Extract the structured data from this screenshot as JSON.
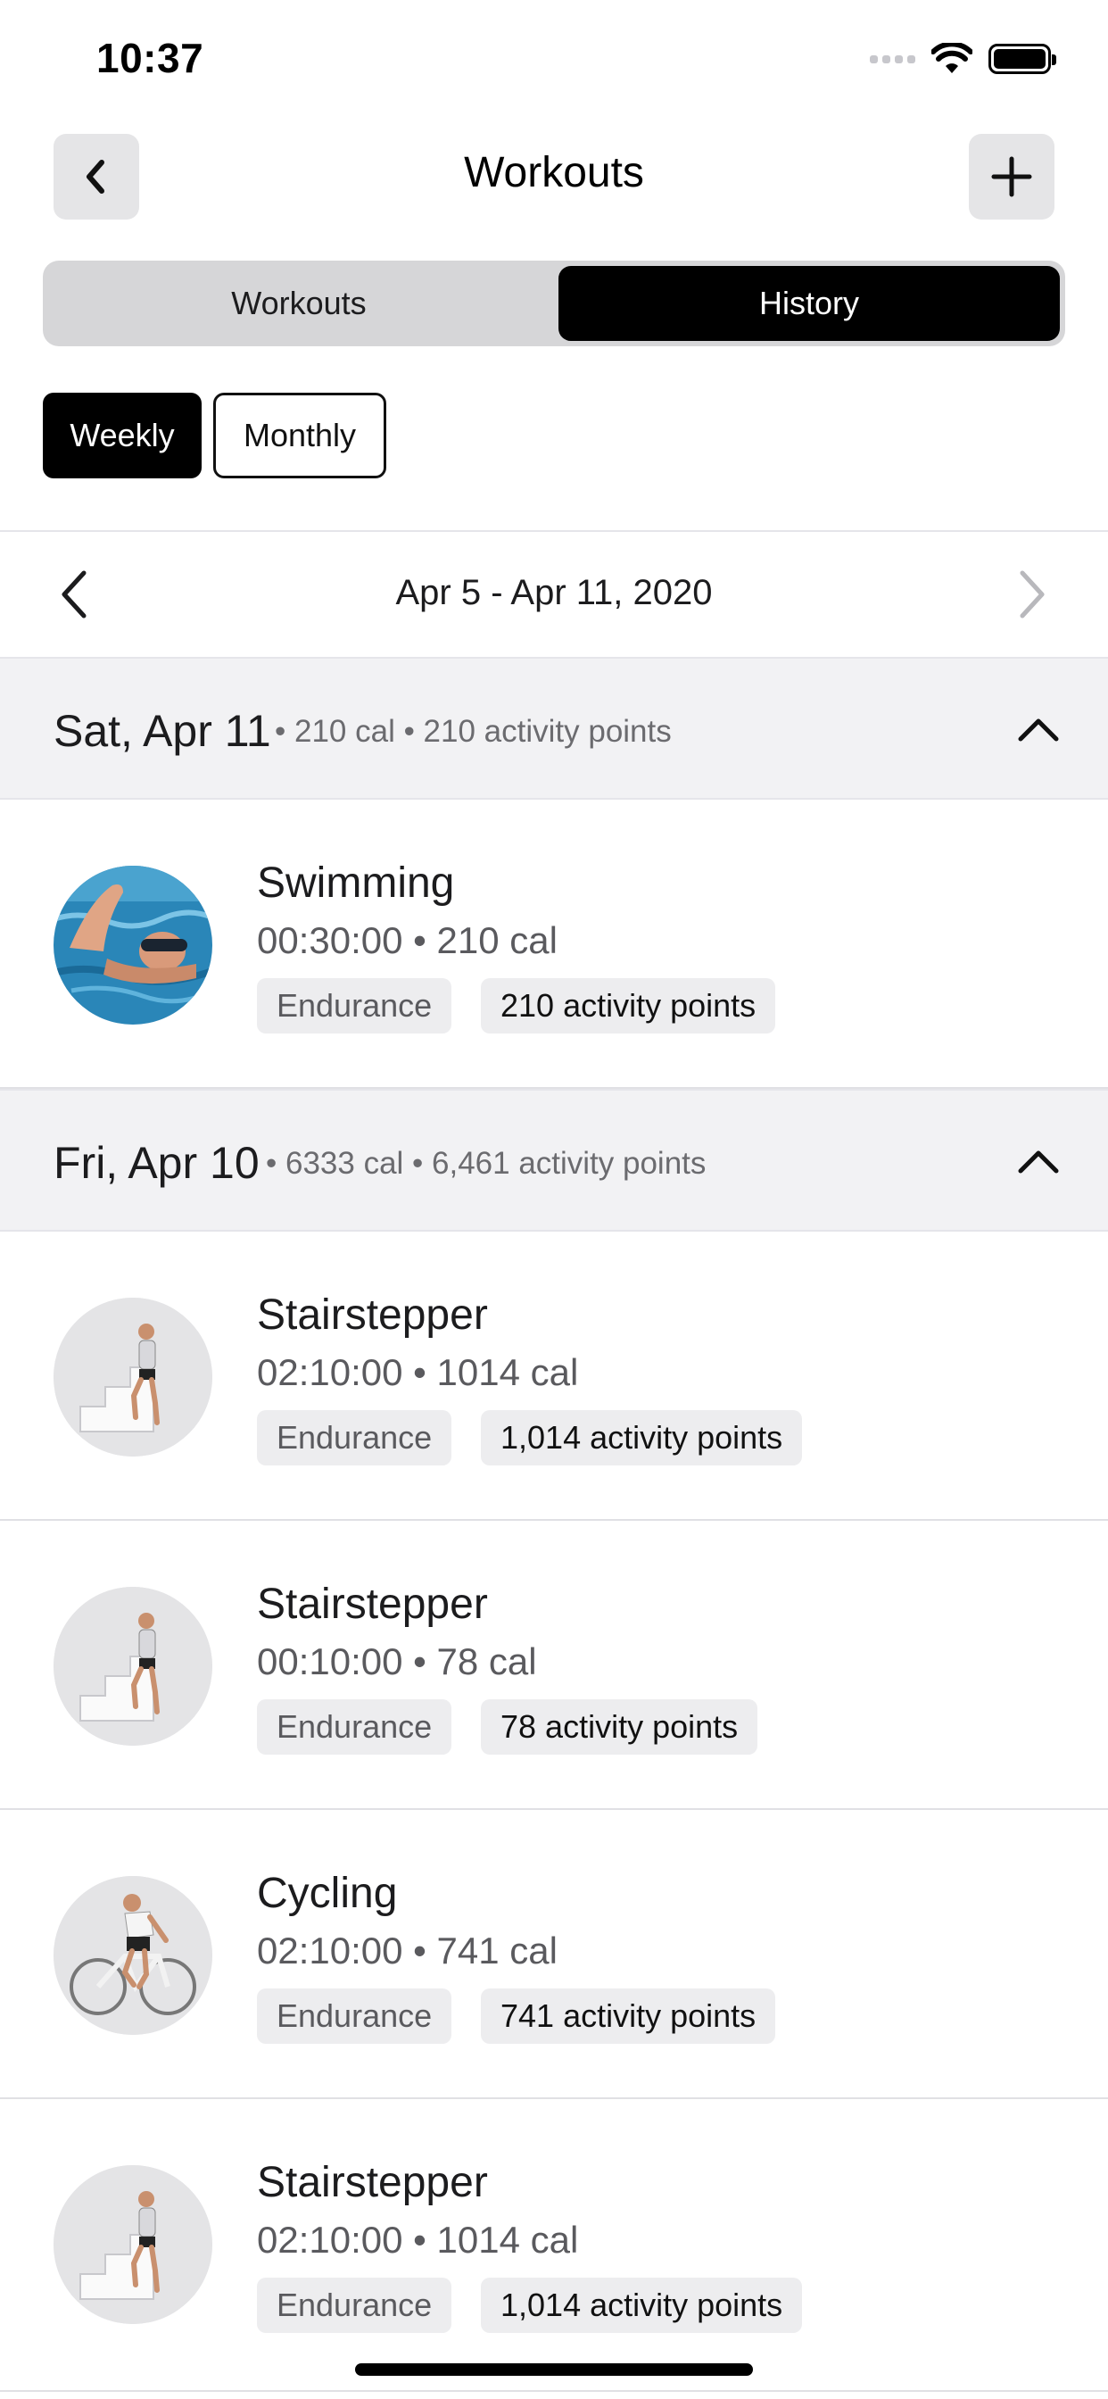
{
  "status_bar": {
    "time": "10:37"
  },
  "nav": {
    "title": "Workouts",
    "back_icon": "chevron-left-icon",
    "add_icon": "plus-icon"
  },
  "segments": {
    "workouts": "Workouts",
    "history": "History",
    "selected": "History"
  },
  "period": {
    "weekly": "Weekly",
    "monthly": "Monthly",
    "selected": "Weekly"
  },
  "range": {
    "label": "Apr 5 - Apr 11, 2020"
  },
  "days": [
    {
      "title": "Sat, Apr 11",
      "summary": "• 210 cal • 210 activity points",
      "workouts": [
        {
          "name": "Swimming",
          "stats": "00:30:00 • 210 cal",
          "type": "Endurance",
          "points": "210 activity points",
          "image": "swimmer"
        }
      ]
    },
    {
      "title": "Fri, Apr 10",
      "summary": "• 6333 cal • 6,461 activity points",
      "workouts": [
        {
          "name": "Stairstepper",
          "stats": "02:10:00 • 1014 cal",
          "type": "Endurance",
          "points": "1,014 activity points",
          "image": "stairstepper"
        },
        {
          "name": "Stairstepper",
          "stats": "00:10:00 • 78 cal",
          "type": "Endurance",
          "points": "78 activity points",
          "image": "stairstepper"
        },
        {
          "name": "Cycling",
          "stats": "02:10:00 • 741 cal",
          "type": "Endurance",
          "points": "741 activity points",
          "image": "cyclist"
        },
        {
          "name": "Stairstepper",
          "stats": "02:10:00 • 1014 cal",
          "type": "Endurance",
          "points": "1,014 activity points",
          "image": "stairstepper"
        }
      ]
    }
  ]
}
